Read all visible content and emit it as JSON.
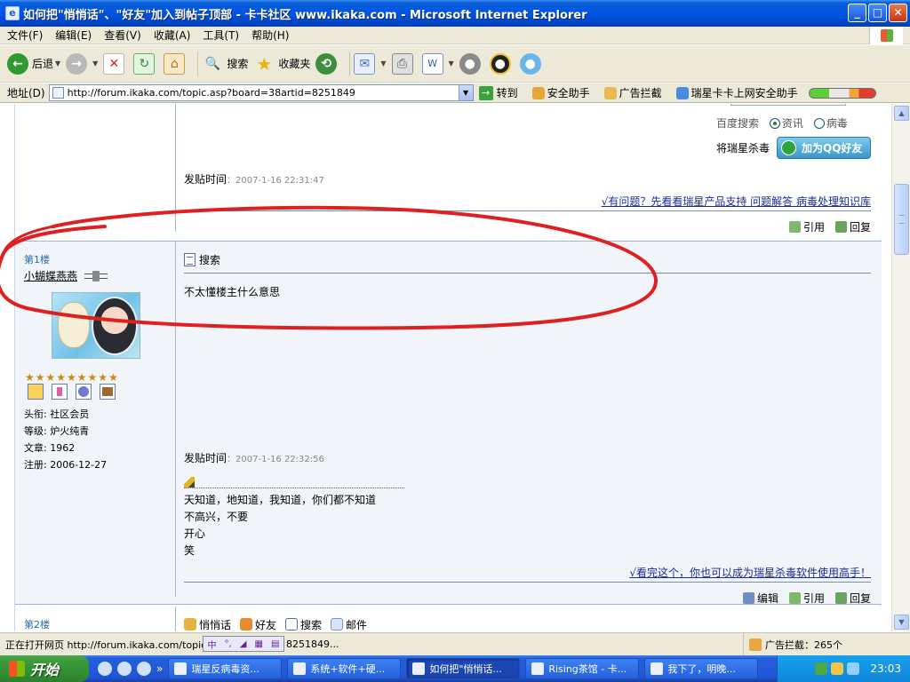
{
  "window": {
    "title": "如何把\"悄悄话\"、\"好友\"加入到帖子顶部 - 卡卡社区 www.ikaka.com - Microsoft Internet Explorer"
  },
  "menu": [
    "文件(F)",
    "编辑(E)",
    "查看(V)",
    "收藏(A)",
    "工具(T)",
    "帮助(H)"
  ],
  "toolbar": {
    "back": "后退",
    "search": "搜索",
    "favorites": "收藏夹"
  },
  "address": {
    "label": "地址(D)",
    "url": "http://forum.ikaka.com/topic.asp?board=38artid=8251849",
    "go": "转到",
    "security_helper": "安全助手",
    "ad_block": "广告拦截",
    "rising_helper": "瑞星卡卡上网安全助手"
  },
  "post0": {
    "baidu_label": "百度搜索",
    "radio_info": "资讯",
    "radio_virus": "病毒",
    "rising_label": "将瑞星杀毒",
    "qq_button": "加为QQ好友",
    "time_label": "发贴时间",
    "time_value": "2007-1-16 22:31:47",
    "sig_link": "√有问题？先看看瑞星产品支持 问题解答 病毒处理知识库",
    "quote": "引用",
    "reply": "回复"
  },
  "post1": {
    "floor": "第1楼",
    "username": "小蝴蝶燕燕",
    "stars": "★★★★★★★★★",
    "info": {
      "rank": "头衔: 社区会员",
      "level": "等级: 炉火纯青",
      "posts": "文章: 1962",
      "registered": "注册: 2006-12-27"
    },
    "title": "搜索",
    "body": "不太懂楼主什么意思",
    "time_label": "发贴时间",
    "time_value": "2007-1-16 22:32:56",
    "signature": [
      "天知道，地知道，我知道，你们都不知道",
      "不高兴，不要",
      "开心",
      "笑"
    ],
    "sig_link": "√看完这个，你也可以成为瑞星杀毒软件使用高手！",
    "edit": "编辑",
    "quote": "引用",
    "reply": "回复"
  },
  "post2": {
    "floor": "第2楼",
    "whisper": "悄悄话",
    "friend": "好友",
    "search": "搜索",
    "mail": "邮件"
  },
  "statusbar": {
    "message": "正在打开网页 http://forum.ikaka.com/topic.a",
    "message_tail": "8251849...",
    "ad_count": "广告拦截：265个"
  },
  "taskbar": {
    "start": "开始",
    "tasks": [
      "瑞星反病毒资...",
      "系统+软件+硬...",
      "如何把\"悄悄话...",
      "Rising茶馆 - 卡...",
      "我下了，明晚..."
    ],
    "clock": "23:03"
  },
  "colors": {
    "annotation": "#e02020",
    "link": "#1a2c9b",
    "floor": "#2b6cb0"
  }
}
